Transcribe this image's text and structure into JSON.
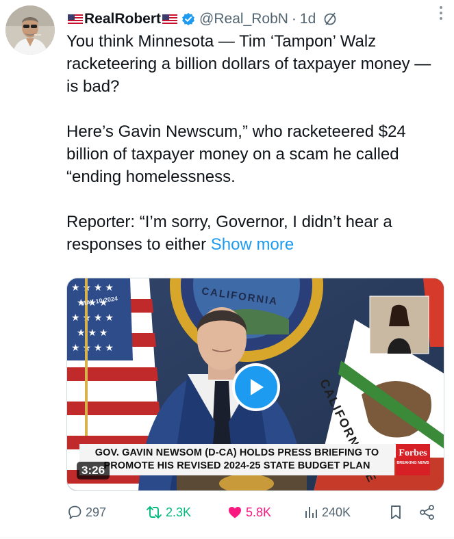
{
  "post": {
    "author_name": "RealRobert",
    "handle": "@Real_RobN",
    "separator": "·",
    "time": "1d",
    "paragraphs": [
      "You think Minnesota — Tim ‘Tampon’ Walz racketeering a billion dollars of taxpayer money — is bad?",
      "Here’s Gavin Newscum,” who racketeered $24 billion of taxpayer money on a scam he called “ending homelessness.",
      "Reporter: “I’m sorry, Governor, I didn’t hear a responses to either"
    ],
    "show_more_label": "Show more"
  },
  "media": {
    "duration": "3:26",
    "lower_third_line1": "GOV. GAVIN NEWSOM (D-CA) HOLDS PRESS BRIEFING TO",
    "lower_third_line2": "PROMOTE HIS REVISED 2024-25 STATE BUDGET PLAN",
    "broadcaster": "Forbes",
    "broadcaster_tag": "BREAKING NEWS",
    "datestamp": "MAY 10 2024",
    "seal_text": "CALIFORNIA",
    "flag_text": "CALIFORNIA RE"
  },
  "actions": {
    "replies": "297",
    "reposts": "2.3K",
    "likes": "5.8K",
    "views": "240K"
  },
  "colors": {
    "accent": "#1d9bf0",
    "repost": "#00ba7c",
    "like": "#f91880",
    "muted": "#536471"
  },
  "icons": [
    "avatar",
    "us-flag-icon",
    "verified-badge-icon",
    "edit-icon",
    "more-icon",
    "play-icon",
    "reply-icon",
    "repost-icon",
    "like-icon",
    "views-icon",
    "bookmark-icon",
    "share-icon"
  ]
}
